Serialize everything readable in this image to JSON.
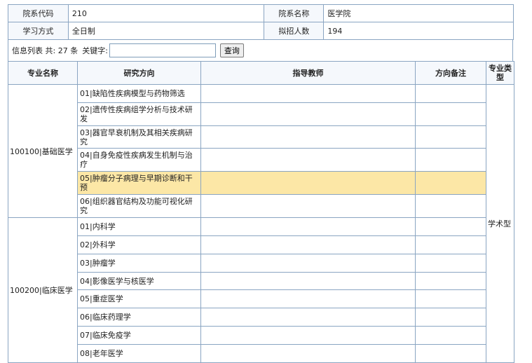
{
  "info": {
    "dept_code_label": "院系代码",
    "dept_code": "210",
    "dept_name_label": "院系名称",
    "dept_name": "医学院",
    "study_mode_label": "学习方式",
    "study_mode": "全日制",
    "plan_count_label": "拟招人数",
    "plan_count": "194"
  },
  "search": {
    "summary": "信息列表 共: 27 条",
    "keyword_label": "关键字:",
    "keyword_value": "",
    "button_label": "查询"
  },
  "table": {
    "headers": {
      "major": "专业名称",
      "direction": "研究方向",
      "advisor": "指导教师",
      "note": "方向备注",
      "type": "专业类型"
    },
    "type_value": "学术型",
    "groups": [
      {
        "major": "100100|基础医学",
        "rows": [
          {
            "direction": "01|缺陷性疾病模型与药物筛选",
            "advisor": "",
            "note": ""
          },
          {
            "direction": "02|遗传性疾病组学分析与技术研发",
            "advisor": "",
            "note": ""
          },
          {
            "direction": "03|器官早衰机制及其相关疾病研究",
            "advisor": "",
            "note": ""
          },
          {
            "direction": "04|自身免疫性疾病发生机制与治疗",
            "advisor": "",
            "note": ""
          },
          {
            "direction": "05|肿瘤分子病理与早期诊断和干预",
            "advisor": "",
            "note": ""
          },
          {
            "direction": "06|组织器官结构及功能可视化研究",
            "advisor": "",
            "note": ""
          }
        ]
      },
      {
        "major": "100200|临床医学",
        "rows": [
          {
            "direction": "01|内科学",
            "advisor": "",
            "note": ""
          },
          {
            "direction": "02|外科学",
            "advisor": "",
            "note": ""
          },
          {
            "direction": "03|肿瘤学",
            "advisor": "",
            "note": ""
          },
          {
            "direction": "04|影像医学与核医学",
            "advisor": "",
            "note": ""
          },
          {
            "direction": "05|重症医学",
            "advisor": "",
            "note": ""
          },
          {
            "direction": "06|临床药理学",
            "advisor": "",
            "note": ""
          },
          {
            "direction": "07|临床免疫学",
            "advisor": "",
            "note": ""
          },
          {
            "direction": "08|老年医学",
            "advisor": "",
            "note": ""
          }
        ]
      }
    ]
  },
  "colors": {
    "border": "#8aa5c2",
    "header_bg": "#f5f8fc",
    "highlight_bg": "#fce7a6"
  }
}
